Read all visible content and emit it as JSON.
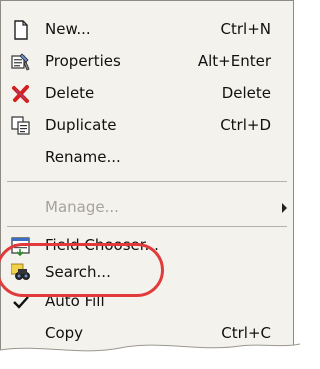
{
  "menu": {
    "items": [
      {
        "label": "New...",
        "shortcut": "Ctrl+N",
        "icon": "new-document-icon",
        "enabled": true
      },
      {
        "label": "Properties",
        "shortcut": "Alt+Enter",
        "icon": "properties-icon",
        "enabled": true
      },
      {
        "label": "Delete",
        "shortcut": "Delete",
        "icon": "delete-icon",
        "enabled": true
      },
      {
        "label": "Duplicate",
        "shortcut": "Ctrl+D",
        "icon": "duplicate-icon",
        "enabled": true
      },
      {
        "label": "Rename...",
        "shortcut": "",
        "icon": "",
        "enabled": true
      },
      {
        "label": "Manage...",
        "shortcut": "",
        "icon": "",
        "enabled": false,
        "submenu": true
      },
      {
        "label": "Field Chooser...",
        "shortcut": "",
        "icon": "field-chooser-icon",
        "enabled": true
      },
      {
        "label": "Search...",
        "shortcut": "",
        "icon": "search-binoculars-icon",
        "enabled": true
      },
      {
        "label": "Auto Fill",
        "shortcut": "",
        "icon": "checkmark-icon",
        "enabled": true,
        "checked": true
      },
      {
        "label": "Copy",
        "shortcut": "Ctrl+C",
        "icon": "",
        "enabled": true
      }
    ]
  },
  "colors": {
    "menu_background": "#f4f2ec",
    "disabled_text": "#a6a39a",
    "highlight_ring": "#e23a3a",
    "delete_icon": "#d42020"
  }
}
